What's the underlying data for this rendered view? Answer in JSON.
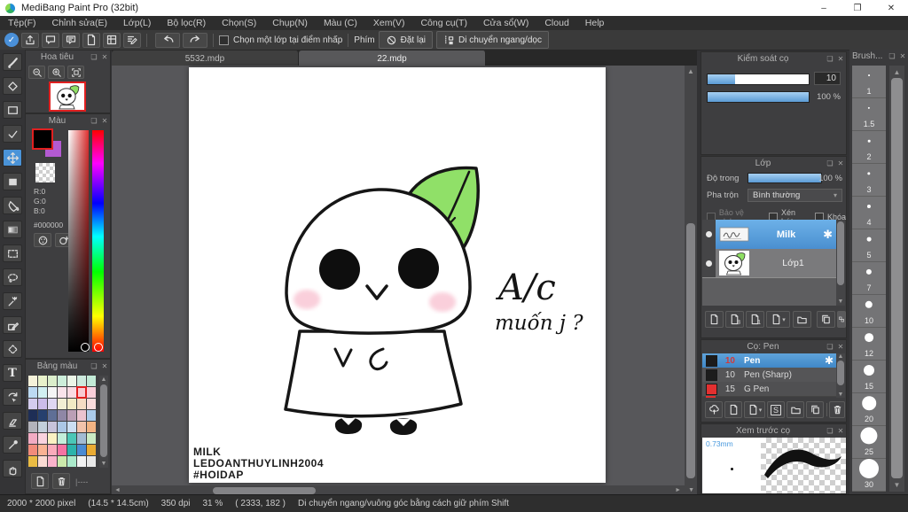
{
  "icons": {
    "popout": "❏",
    "close": "✕",
    "gear": "✱",
    "up": "▲",
    "down": "▼",
    "left": "◄",
    "right": "►",
    "caret": "▾",
    "check": "✓",
    "dots": "|----"
  },
  "window": {
    "title": "MediBang Paint Pro (32bit)",
    "minimize": "–",
    "restore": "❐",
    "close": "✕"
  },
  "menu": {
    "items": [
      "Tệp(F)",
      "Chỉnh sửa(E)",
      "Lớp(L)",
      "Bộ lọc(R)",
      "Chọn(S)",
      "Chụp(N)",
      "Màu (C)",
      "Xem(V)",
      "Công cụ(T)",
      "Cửa sổ(W)",
      "Cloud",
      "Help"
    ]
  },
  "toolbar": {
    "select_layer_checkbox": "Chọn một lớp tại điểm nhấp",
    "key_label": "Phím",
    "reset_button": "Đặt lại",
    "move_button": "Di chuyển ngang/dọc"
  },
  "tabs": {
    "tab1": "5532.mdp",
    "tab2": "22.mdp"
  },
  "navigator": {
    "title": "Hoa tiêu"
  },
  "color": {
    "title": "Màu",
    "r": "R:0",
    "g": "G:0",
    "b": "B:0",
    "hex": "#000000"
  },
  "palette": {
    "title": "Bảng màu",
    "selected_index": 12,
    "swatches": [
      "#f5f2d9",
      "#e9f2cb",
      "#dbeecb",
      "#cdeeda",
      "#ecf6e8",
      "#cdeadd",
      "#c2ead6",
      "#bcdaf2",
      "#d2f0f2",
      "#f5f5f5",
      "#fae3ea",
      "#fadbe3",
      "#f8cbd3",
      "#facfda",
      "#d4ccee",
      "#ccbcea",
      "#dfd7f2",
      "#f2eed3",
      "#f2eac4",
      "#f6dcc4",
      "#fadcdc",
      "#1e2e56",
      "#26406e",
      "#5f6f96",
      "#8f87a6",
      "#bb9fb6",
      "#eac3cf",
      "#abcbea",
      "#b3b3bb",
      "#c3cfda",
      "#c7c3da",
      "#abc7e6",
      "#cbdef2",
      "#f2c3ab",
      "#f2b383",
      "#f2abc3",
      "#fad3de",
      "#faf2c3",
      "#c3eeda",
      "#4bc7b7",
      "#a3bbd3",
      "#cbeac3",
      "#f28b7b",
      "#fab393",
      "#faabbb",
      "#f573a3",
      "#2bb3ab",
      "#4b8bd3",
      "#eaab33",
      "#eabb43",
      "#fadbd3",
      "#fab3cb",
      "#cbeaab",
      "#abeacb",
      "#f2f2f2",
      "#e8e8e8"
    ]
  },
  "brush_control": {
    "title": "Kiểm soát cọ",
    "size": "10",
    "opacity": "100 %"
  },
  "layer": {
    "title": "Lớp",
    "opacity_label": "Độ trong",
    "opacity_value": "100 %",
    "blend_label": "Pha trộn",
    "blend_value": "Bình thường",
    "cb_alpha": "Bảo vệ alpha",
    "cb_clip": "Xén bớt",
    "cb_lock": "Khóa",
    "layers": [
      {
        "name": "Milk"
      },
      {
        "name": "Lớp1"
      }
    ]
  },
  "brush": {
    "title": "Cọ: Pen",
    "items": [
      {
        "size": "10",
        "name": "Pen"
      },
      {
        "size": "10",
        "name": "Pen (Sharp)"
      },
      {
        "size": "15",
        "name": "G Pen"
      }
    ]
  },
  "brush_preview": {
    "title": "Xem trước cọ",
    "size_label": "0.73mm"
  },
  "brush_sizes": {
    "title": "Brush...",
    "sizes": [
      "1",
      "1.5",
      "2",
      "3",
      "4",
      "5",
      "7",
      "10",
      "12",
      "15",
      "20",
      "25",
      "30"
    ]
  },
  "canvas": {
    "speech1": "A/c",
    "speech2": "muốn j ?",
    "credit1": "MILK",
    "credit2": "LEDOANTHUYLINH2004",
    "credit3": "#HOIDAP"
  },
  "statusbar": {
    "dims": "2000 * 2000 pixel",
    "size_cm": "(14.5 * 14.5cm)",
    "dpi": "350 dpi",
    "zoom": "31 %",
    "coords": "( 2333, 182 )",
    "hint": "Di chuyển ngang/vuông góc bằng cách giữ phím Shift"
  }
}
